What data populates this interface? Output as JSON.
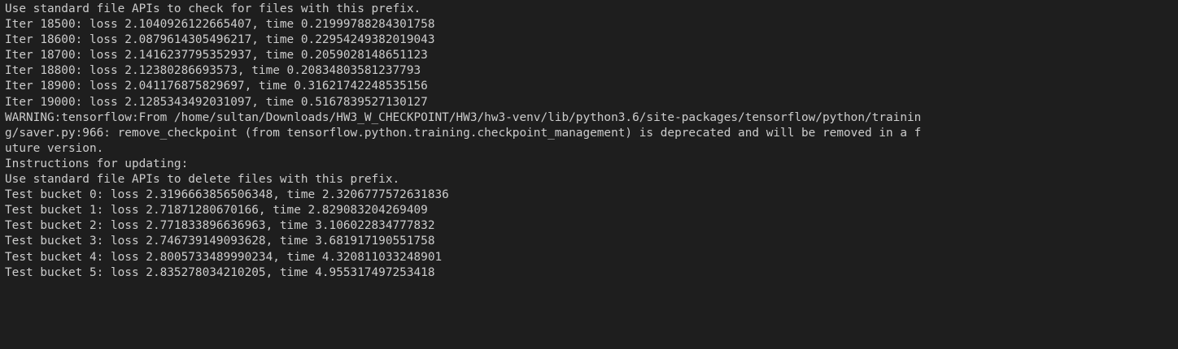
{
  "terminal": {
    "lines": [
      "Use standard file APIs to check for files with this prefix.",
      "Iter 18500: loss 2.1040926122665407, time 0.21999788284301758",
      "Iter 18600: loss 2.0879614305496217, time 0.22954249382019043",
      "Iter 18700: loss 2.1416237795352937, time 0.2059028148651123",
      "Iter 18800: loss 2.12380286693573, time 0.20834803581237793",
      "Iter 18900: loss 2.041176875829697, time 0.31621742248535156",
      "Iter 19000: loss 2.1285343492031097, time 0.5167839527130127",
      "WARNING:tensorflow:From /home/sultan/Downloads/HW3_W_CHECKPOINT/HW3/hw3-venv/lib/python3.6/site-packages/tensorflow/python/trainin",
      "g/saver.py:966: remove_checkpoint (from tensorflow.python.training.checkpoint_management) is deprecated and will be removed in a f",
      "uture version.",
      "Instructions for updating:",
      "Use standard file APIs to delete files with this prefix.",
      "Test bucket 0: loss 2.3196663856506348, time 2.3206777572631836",
      "Test bucket 1: loss 2.71871280670166, time 2.829083204269409",
      "Test bucket 2: loss 2.771833896636963, time 3.106022834777832",
      "Test bucket 3: loss 2.746739149093628, time 3.681917190551758",
      "Test bucket 4: loss 2.8005733489990234, time 4.320811033248901",
      "Test bucket 5: loss 2.835278034210205, time 4.955317497253418"
    ]
  },
  "colors": {
    "background": "#1e1e1e",
    "text": "#cccccc"
  }
}
